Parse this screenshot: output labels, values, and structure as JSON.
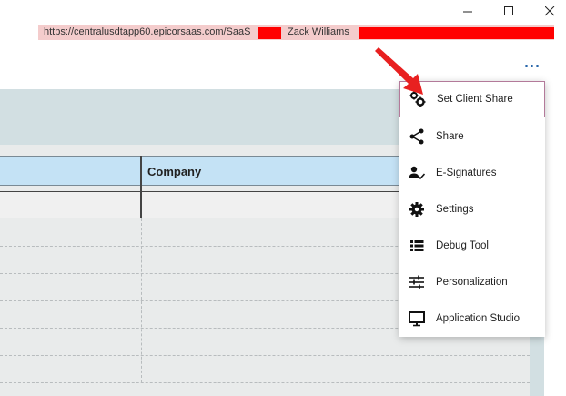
{
  "window": {
    "minimize_glyph": "—",
    "maximize_glyph": "☐",
    "close_glyph": "✕"
  },
  "header": {
    "url": "https://centralusdtapp60.epicorsaas.com/SaaS",
    "user": "Zack Williams",
    "redaction_color": "#ff0000",
    "banner_color": "#f4cccc"
  },
  "grid": {
    "columns": [
      "",
      "Company"
    ]
  },
  "menu": {
    "items": [
      {
        "label": "Set Client Share",
        "icon": "gears-icon"
      },
      {
        "label": "Share",
        "icon": "share-icon"
      },
      {
        "label": "E-Signatures",
        "icon": "e-signature-icon"
      },
      {
        "label": "Settings",
        "icon": "gear-icon"
      },
      {
        "label": "Debug Tool",
        "icon": "list-icon"
      },
      {
        "label": "Personalization",
        "icon": "sliders-icon"
      },
      {
        "label": "Application Studio",
        "icon": "monitor-icon"
      }
    ]
  },
  "colors": {
    "accent": "#1f5fa6",
    "grid_header": "#c4e2f5",
    "pointer": "#e82020"
  }
}
